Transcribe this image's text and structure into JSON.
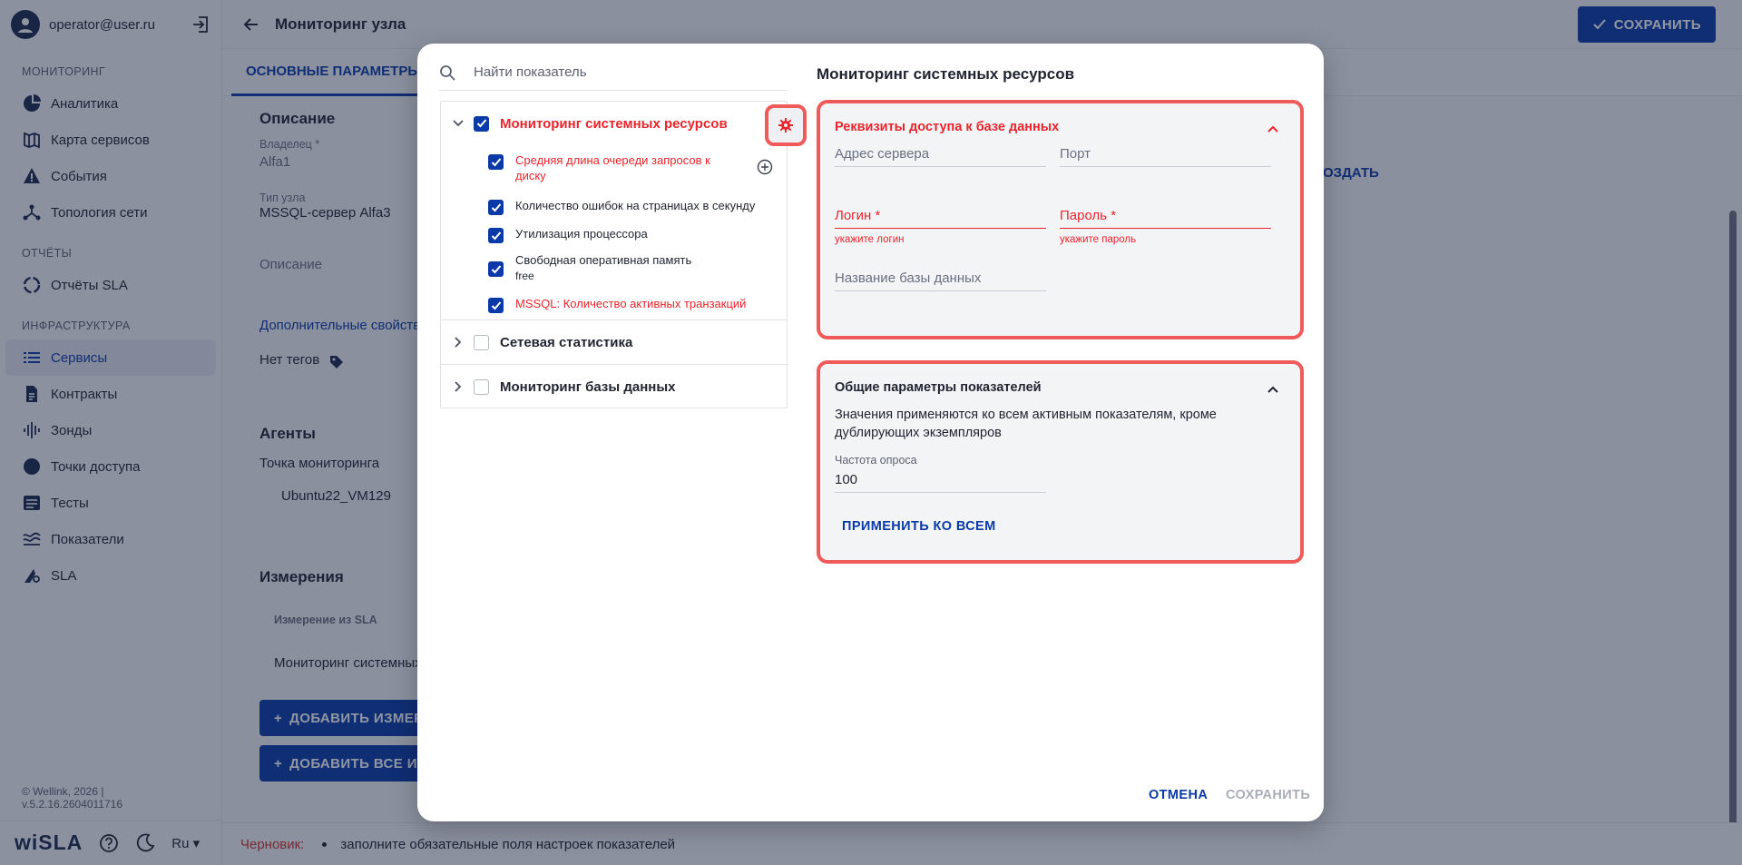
{
  "user": {
    "email": "operator@user.ru"
  },
  "sidebar": {
    "sections": [
      {
        "title": "МОНИТОРИНГ",
        "items": [
          {
            "label": "Аналитика",
            "icon": "pie-chart-icon"
          },
          {
            "label": "Карта сервисов",
            "icon": "map-icon"
          },
          {
            "label": "События",
            "icon": "warning-icon"
          },
          {
            "label": "Топология сети",
            "icon": "topology-icon"
          }
        ]
      },
      {
        "title": "ОТЧЁТЫ",
        "items": [
          {
            "label": "Отчёты SLA",
            "icon": "refresh-circle-icon"
          }
        ]
      },
      {
        "title": "ИНФРАСТРУКТУРА",
        "items": [
          {
            "label": "Сервисы",
            "icon": "list-icon",
            "active": true
          },
          {
            "label": "Контракты",
            "icon": "document-icon"
          },
          {
            "label": "Зонды",
            "icon": "signal-icon"
          },
          {
            "label": "Точки доступа",
            "icon": "circle-icon"
          },
          {
            "label": "Тесты",
            "icon": "tests-icon"
          },
          {
            "label": "Показатели",
            "icon": "metrics-icon"
          },
          {
            "label": "SLA",
            "icon": "sla-icon"
          }
        ]
      }
    ],
    "copyright": "© Wellink, 2026 | v.5.2.16.2604011716",
    "brand": "wiSLA",
    "language": "Ru"
  },
  "header": {
    "title": "Мониторинг узла",
    "save_label": "СОХРАНИТЬ"
  },
  "tabs": {
    "main": "ОСНОВНЫЕ ПАРАМЕТРЫ"
  },
  "content": {
    "description_title": "Описание",
    "owner_label": "Владелец *",
    "owner_value": "Alfa1",
    "node_type_label": "Тип узла",
    "node_type_value": "MSSQL-сервер Alfa3",
    "description_placeholder": "Описание",
    "extra_props_link": "Дополнительные свойства",
    "no_tags": "Нет тегов",
    "create_link": "ОЗДАТЬ",
    "agents_title": "Агенты",
    "monitoring_point_label": "Точка мониторинга",
    "monitoring_point_value": "Ubuntu22_VM129",
    "measurements_title": "Измерения",
    "measurement_column": "Измерение из SLA",
    "measurement_row": "Мониторинг системных",
    "add_measurement_button": "ДОБАВИТЬ ИЗМЕР",
    "add_all_button": "ДОБАВИТЬ ВСЕ ИЗ"
  },
  "statusbar": {
    "draft_label": "Черновик:",
    "message": "заполните обязательные поля настроек показателей"
  },
  "modal": {
    "search_placeholder": "Найти показатель",
    "groups": [
      {
        "label": "Мониторинг системных ресурсов",
        "checked": true,
        "expanded": true,
        "error": true,
        "items": [
          {
            "label": "Средняя длина очереди запросов к",
            "label2": "диску",
            "checked": true,
            "error": true
          },
          {
            "label": "Количество ошибок на страницах в секунду",
            "checked": true,
            "error": false
          },
          {
            "label": "Утилизация процессора",
            "checked": true,
            "error": false
          },
          {
            "label": "Свободная оперативная память",
            "label2": "free",
            "checked": true,
            "error": false
          },
          {
            "label": "MSSQL: Количество активных транзакций",
            "checked": true,
            "error": true
          }
        ]
      },
      {
        "label": "Сетевая статистика",
        "checked": false,
        "expanded": false
      },
      {
        "label": "Мониторинг базы данных",
        "checked": false,
        "expanded": false
      }
    ],
    "right_title": "Мониторинг системных ресурсов",
    "credentials": {
      "title": "Реквизиты доступа к базе данных",
      "server_placeholder": "Адрес сервера",
      "port_placeholder": "Порт",
      "login_label": "Логин *",
      "login_hint": "укажите логин",
      "password_label": "Пароль *",
      "password_hint": "укажите пароль",
      "db_name_placeholder": "Название базы данных"
    },
    "common": {
      "title": "Общие параметры показателей",
      "description": "Значения применяются ко всем активным показателям, кроме дублирующих экземпляров",
      "poll_label": "Частота опроса",
      "poll_value": "100",
      "apply_label": "ПРИМЕНИТЬ КО ВСЕМ"
    },
    "cancel_label": "ОТМЕНА",
    "save_label": "СОХРАНИТЬ"
  },
  "colors": {
    "accent": "#0a3aa8",
    "error": "#e8242c",
    "highlight": "#ef5a5a"
  }
}
